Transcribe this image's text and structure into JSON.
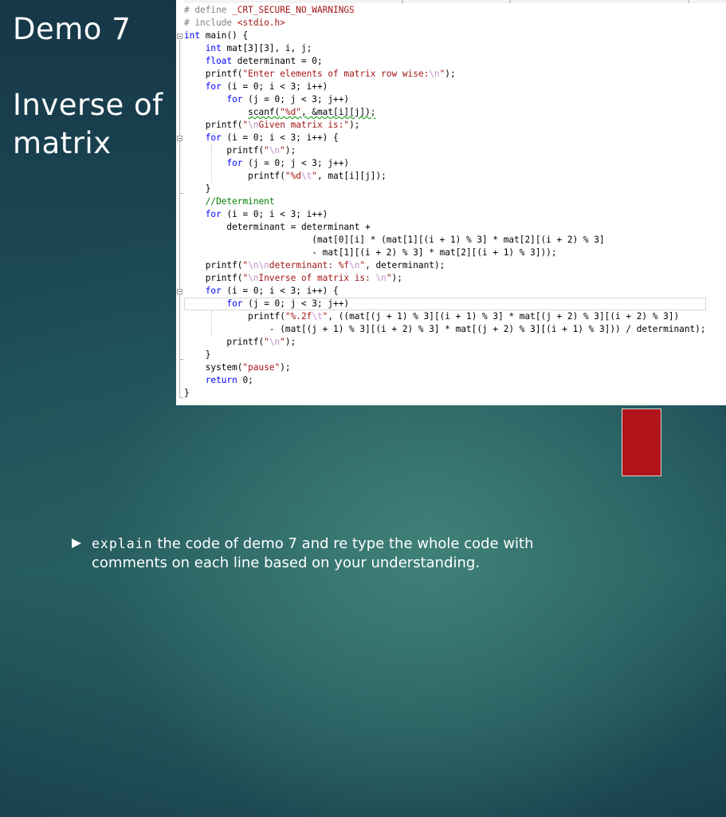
{
  "slide": {
    "title": "Demo 7",
    "subtitle": "Inverse of matrix"
  },
  "code": {
    "lines": [
      "# define _CRT_SECURE_NO_WARNINGS",
      "# include <stdio.h>",
      "int main() {",
      "    int mat[3][3], i, j;",
      "    float determinant = 0;",
      "    printf(\"Enter elements of matrix row wise:\\n\");",
      "    for (i = 0; i < 3; i++)",
      "        for (j = 0; j < 3; j++)",
      "            scanf(\"%d\", &mat[i][j]);",
      "    printf(\"\\nGiven matrix is:\");",
      "    for (i = 0; i < 3; i++) {",
      "        printf(\"\\n\");",
      "        for (j = 0; j < 3; j++)",
      "            printf(\"%d\\t\", mat[i][j]);",
      "    }",
      "    //Determinent",
      "    for (i = 0; i < 3; i++)",
      "        determinant = determinant +",
      "                        (mat[0][i] * (mat[1][(i + 1) % 3] * mat[2][(i + 2) % 3]",
      "                        - mat[1][(i + 2) % 3] * mat[2][(i + 1) % 3]));",
      "    printf(\"\\n\\ndeterminant: %f\\n\", determinant);",
      "    printf(\"\\nInverse of matrix is: \\n\");",
      "    for (i = 0; i < 3; i++) {",
      "        for (j = 0; j < 3; j++)",
      "            printf(\"%.2f\\t\", ((mat[(j + 1) % 3][(i + 1) % 3] * mat[(j + 2) % 3][(i + 2) % 3])",
      "                - (mat[(j + 1) % 3][(i + 2) % 3] * mat[(j + 2) % 3][(i + 1) % 3])) / determinant);",
      "        printf(\"\\n\");",
      "    }",
      "    system(\"pause\");",
      "    return 0;",
      "}"
    ]
  },
  "instruction": {
    "keyword": "explain",
    "text": " the code of demo 7 and re type the whole code with comments on each line based on your understanding."
  },
  "colors": {
    "accent_box": "#b11519",
    "keyword": "#0000ff",
    "string": "#a31515",
    "comment": "#008000",
    "preprocessor": "#808080"
  }
}
